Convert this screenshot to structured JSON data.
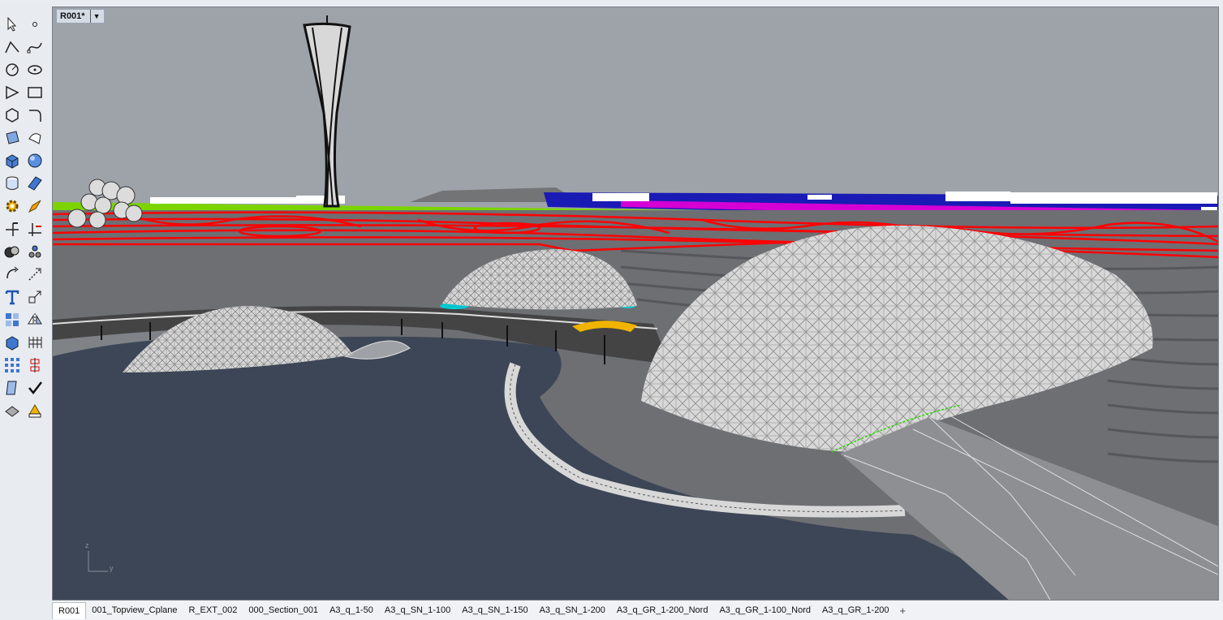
{
  "viewport": {
    "title": "R001*",
    "dropdown_icon": "caret-down-icon",
    "axis_z": "z",
    "axis_y": "y"
  },
  "toolbar": {
    "tools": [
      "select-arrow-icon",
      "point-icon",
      "polyline-icon",
      "curve-icon",
      "circle-icon",
      "ellipse-icon",
      "arc-icon",
      "rectangle-icon",
      "polygon-icon",
      "fillet-icon",
      "surface-icon",
      "patch-icon",
      "box-icon",
      "sphere-icon",
      "cylinder-icon",
      "plane-icon",
      "gear-icon",
      "edit-icon",
      "split-icon",
      "trim-icon",
      "boolean-icon",
      "group-icon",
      "rotate-icon",
      "scale-icon",
      "text-icon",
      "transform-icon",
      "array-icon",
      "mirror-icon",
      "solid-tools-icon",
      "mesh-icon",
      "grid-icon",
      "dimension-icon",
      "analyze-icon",
      "check-icon",
      "render-icon",
      "material-icon"
    ]
  },
  "tabs": {
    "items": [
      "R001",
      "001_Topview_Cplane",
      "R_EXT_002",
      "000_Section_001",
      "A3_q_1-50",
      "A3_q_SN_1-100",
      "A3_q_SN_1-150",
      "A3_q_SN_1-200",
      "A3_q_GR_1-200_Nord",
      "A3_q_GR_1-100_Nord",
      "A3_q_GR_1-200"
    ],
    "active": "R001",
    "add_label": "+"
  },
  "colors": {
    "sky": "#9ea3aa",
    "ground": "#6d6f73",
    "water": "#3d4656",
    "roads": "#ff0000",
    "accent_blue": "#1a1ab4",
    "magenta": "#d400d4",
    "green": "#7bd400",
    "dome": "#d8d8d8",
    "yellow": "#f0b400"
  }
}
